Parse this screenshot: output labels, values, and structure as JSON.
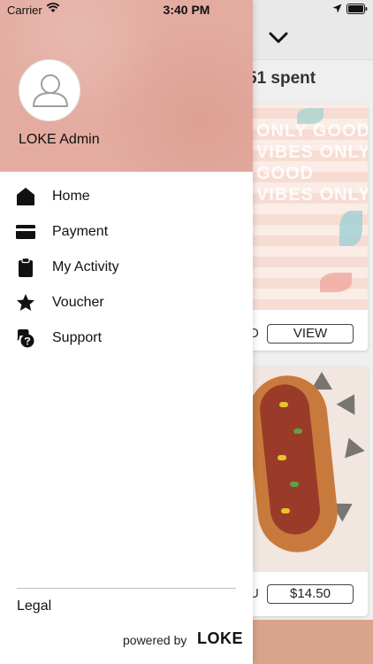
{
  "status_bar": {
    "carrier": "Carrier",
    "time": "3:40 PM"
  },
  "drawer": {
    "user_name": "LOKE Admin",
    "menu": [
      {
        "label": "Home",
        "icon": "home-icon"
      },
      {
        "label": "Payment",
        "icon": "credit-card-icon"
      },
      {
        "label": "My Activity",
        "icon": "clipboard-icon"
      },
      {
        "label": "Voucher",
        "icon": "star-icon"
      },
      {
        "label": "Support",
        "icon": "chat-question-icon"
      }
    ],
    "legal_label": "Legal",
    "powered_by": "powered by",
    "brand": "LOKE"
  },
  "background": {
    "heading_partial": "51 spent",
    "cards": [
      {
        "cut_text": "D",
        "button_label": "VIEW",
        "image_text": "ONLY GOOD VIBES ONLY GOOD VIBES ONLY"
      },
      {
        "cut_text": "U",
        "button_label": "$14.50"
      }
    ]
  },
  "colors": {
    "header_pink": "#e4aca0",
    "drawer_bg": "#ffffff",
    "text": "#111111"
  }
}
